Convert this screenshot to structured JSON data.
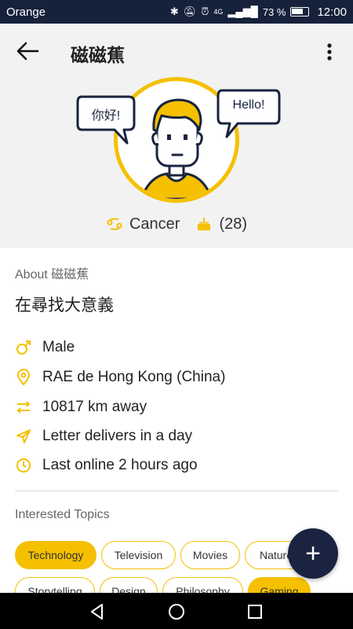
{
  "status_bar": {
    "carrier": "Orange",
    "network": "4G",
    "battery_percent": "73 %",
    "time": "12:00"
  },
  "app_bar": {
    "title": "磁磁蕉"
  },
  "profile": {
    "bubble_left": "你好!",
    "bubble_right": "Hello!",
    "zodiac": "Cancer",
    "age": "(28)"
  },
  "about": {
    "label": "About 磁磁蕉",
    "bio": "在尋找大意義",
    "gender": "Male",
    "location": "RAE de Hong Kong (China)",
    "distance": "10817 km away",
    "delivery": "Letter delivers in a day",
    "last_online": "Last online 2 hours ago"
  },
  "topics": {
    "label": "Interested Topics",
    "row1": [
      {
        "label": "Technology",
        "active": true
      },
      {
        "label": "Television",
        "active": false
      },
      {
        "label": "Movies",
        "active": false
      },
      {
        "label": "Nature",
        "active": false
      }
    ],
    "row2": [
      {
        "label": "Storytelling",
        "active": false
      },
      {
        "label": "Design",
        "active": false
      },
      {
        "label": "Philosophy",
        "active": false
      },
      {
        "label": "Gaming",
        "active": true
      }
    ]
  },
  "fab": {
    "label": "+"
  },
  "colors": {
    "accent": "#f5c000",
    "dark": "#1a2440",
    "status_bar": "#16213b"
  }
}
